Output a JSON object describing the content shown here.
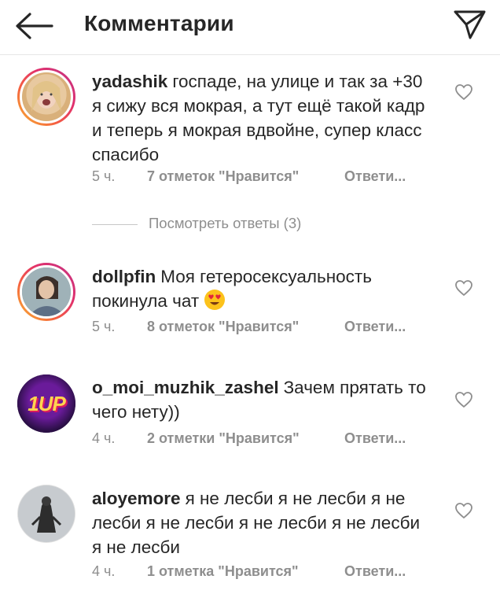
{
  "header": {
    "title": "Комментарии",
    "back_icon": "arrow-left-icon",
    "send_icon": "paper-plane-icon"
  },
  "comments": [
    {
      "username": "yadashik",
      "text": "госпаде, на улице и так за +30 я сижу вся мокрая, а тут ещё такой кадр и теперь я мокрая вдвойне, супер класс спасибо",
      "time": "5 ч.",
      "likes": "7 отметок \"Нравится\"",
      "reply": "Ответи..."
    },
    {
      "username": "dollpfin",
      "text": "Моя гетеросексуальность покинула чат",
      "emoji": "heart-eyes-emoji",
      "time": "5 ч.",
      "likes": "8 отметок \"Нравится\"",
      "reply": "Ответи..."
    },
    {
      "username": "o_moi_muzhik_zashel",
      "text": "Зачем прятать то чего нету))",
      "avatar_text": "1UP",
      "time": "4 ч.",
      "likes": "2 отметки \"Нравится\"",
      "reply": "Ответи..."
    },
    {
      "username": "aloyemore",
      "text": "я не лесби я не лесби я не лесби я не лесби я не лесби я не лесби я не лесби",
      "time": "4 ч.",
      "likes": "1 отметка \"Нравится\"",
      "reply": "Ответи..."
    }
  ],
  "view_replies": "Посмотреть ответы (3)",
  "colors": {
    "text": "#262626",
    "secondary": "#8e8e8e",
    "story_ring_start": "#f7b731",
    "story_ring_end": "#c13584"
  }
}
